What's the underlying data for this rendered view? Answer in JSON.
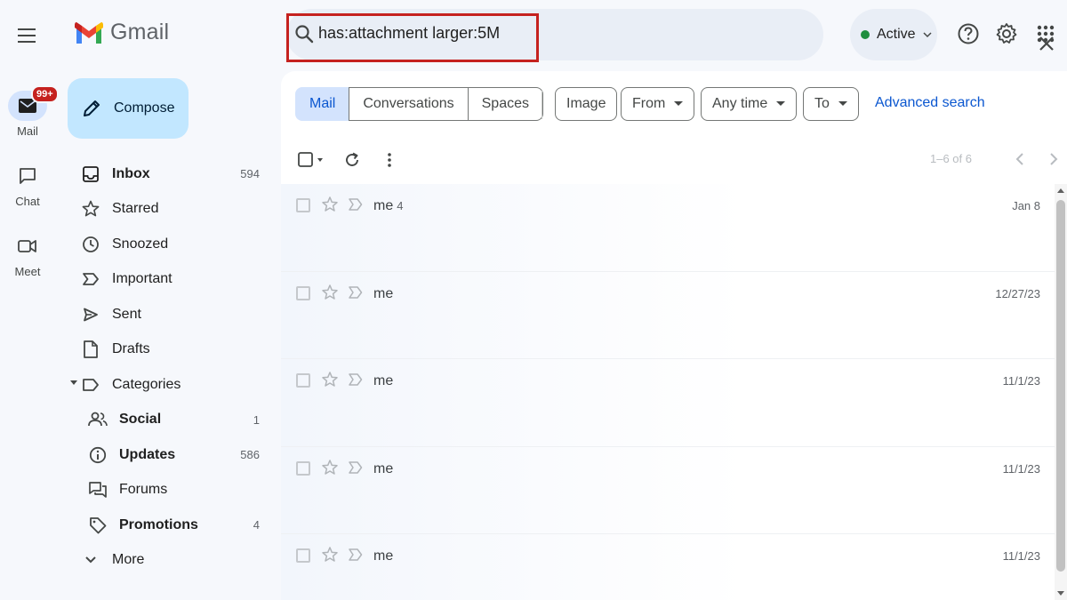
{
  "app": {
    "name": "Gmail"
  },
  "search": {
    "value": "has:attachment larger:5M"
  },
  "status": {
    "label": "Active",
    "color": "#1e8e3e"
  },
  "rail": {
    "mail": {
      "label": "Mail",
      "badge": "99+"
    },
    "chat": {
      "label": "Chat"
    },
    "meet": {
      "label": "Meet"
    }
  },
  "compose": {
    "label": "Compose"
  },
  "nav": {
    "inbox": {
      "label": "Inbox",
      "count": "594"
    },
    "starred": {
      "label": "Starred"
    },
    "snoozed": {
      "label": "Snoozed"
    },
    "important": {
      "label": "Important"
    },
    "sent": {
      "label": "Sent"
    },
    "drafts": {
      "label": "Drafts"
    },
    "categories": {
      "label": "Categories"
    },
    "social": {
      "label": "Social",
      "count": "1"
    },
    "updates": {
      "label": "Updates",
      "count": "586"
    },
    "forums": {
      "label": "Forums"
    },
    "promotions": {
      "label": "Promotions",
      "count": "4"
    },
    "more": {
      "label": "More"
    }
  },
  "filters": {
    "segments": [
      "Mail",
      "Conversations",
      "Spaces"
    ],
    "image": "Image",
    "from": "From",
    "any_time": "Any time",
    "to": "To",
    "advanced": "Advanced search"
  },
  "pagination": {
    "range": "1–6 of 6"
  },
  "emails": [
    {
      "sender": "me",
      "count": "4",
      "date": "Jan 8"
    },
    {
      "sender": "me",
      "count": "",
      "date": "12/27/23"
    },
    {
      "sender": "me",
      "count": "",
      "date": "11/1/23"
    },
    {
      "sender": "me",
      "count": "",
      "date": "11/1/23"
    },
    {
      "sender": "me",
      "count": "",
      "date": "11/1/23"
    }
  ],
  "colors": {
    "accent": "#0b57d0",
    "compose_bg": "#c2e7ff",
    "highlight": "#c5221f",
    "badge": "#c5221f"
  }
}
